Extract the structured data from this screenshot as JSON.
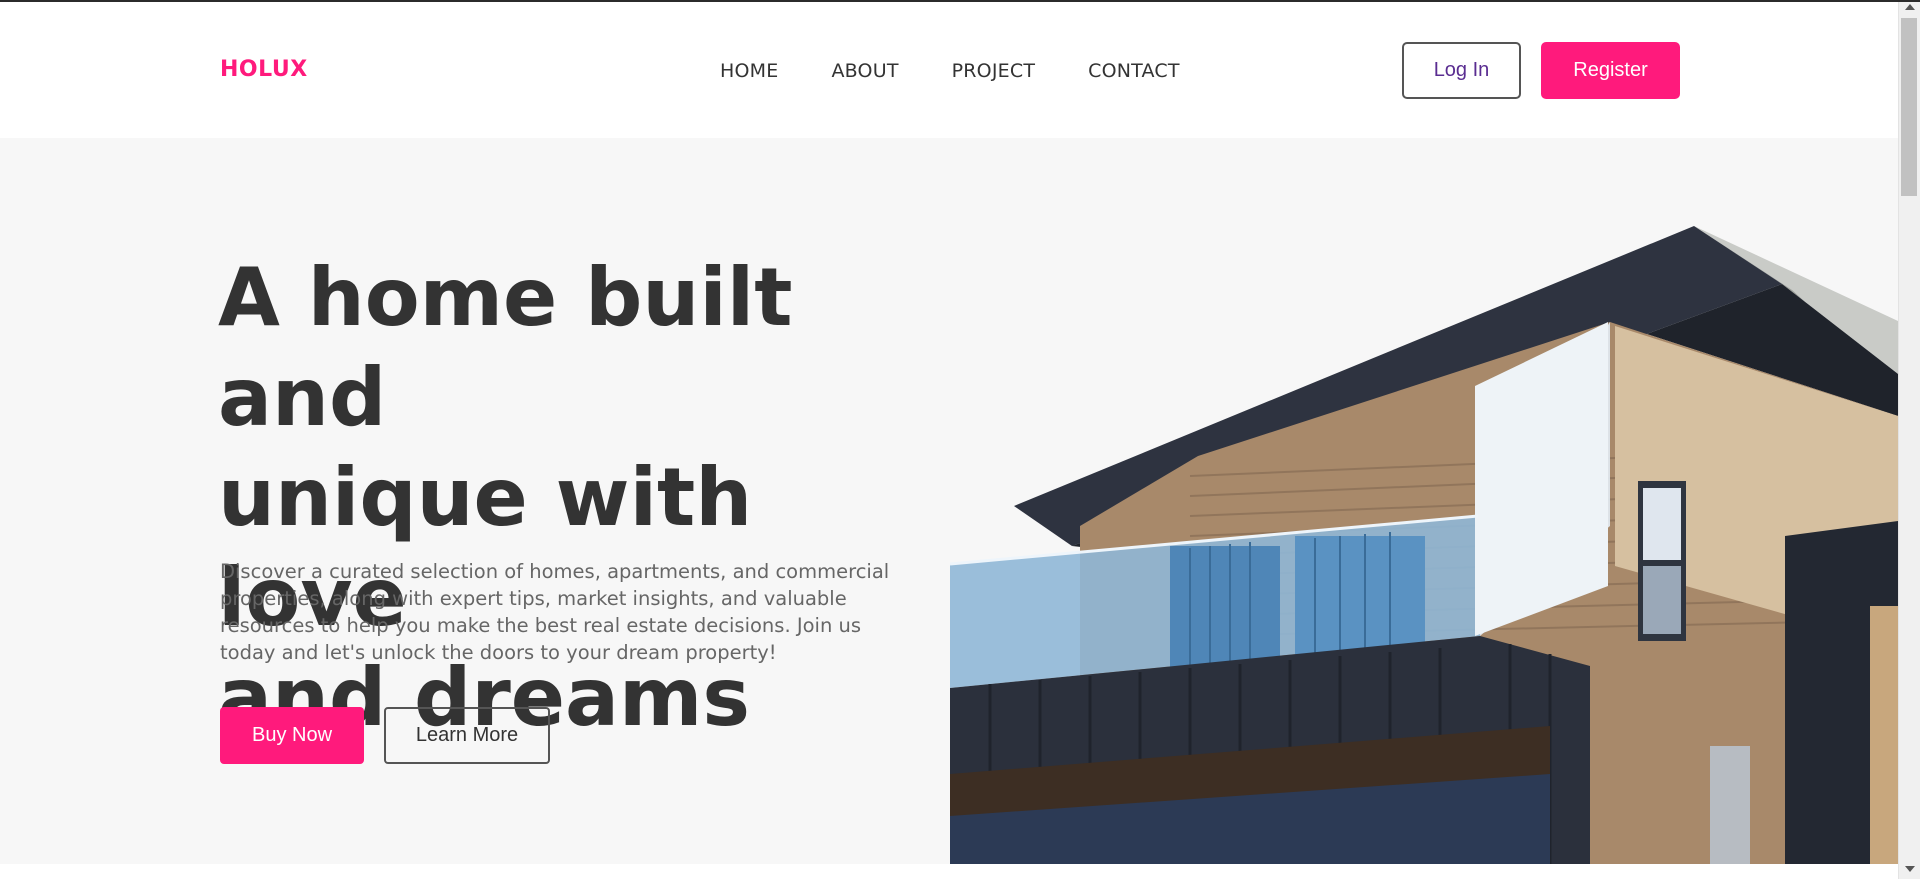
{
  "brand": {
    "logo": "HOLUX",
    "accent_color": "#ff1a7c"
  },
  "nav": {
    "items": [
      "HOME",
      "ABOUT",
      "PROJECT",
      "CONTACT"
    ]
  },
  "auth": {
    "login_label": "Log In",
    "register_label": "Register"
  },
  "hero": {
    "headline_lines": [
      "A home built and",
      "unique with love",
      "and dreams"
    ],
    "description": "Discover a curated selection of homes, apartments, and commercial properties, along with expert tips, market insights, and valuable resources to help you make the best real estate decisions. Join us today and let's unlock the doors to your dream property!",
    "buy_label": "Buy Now",
    "learn_label": "Learn More",
    "image": "modern-house-photo"
  }
}
